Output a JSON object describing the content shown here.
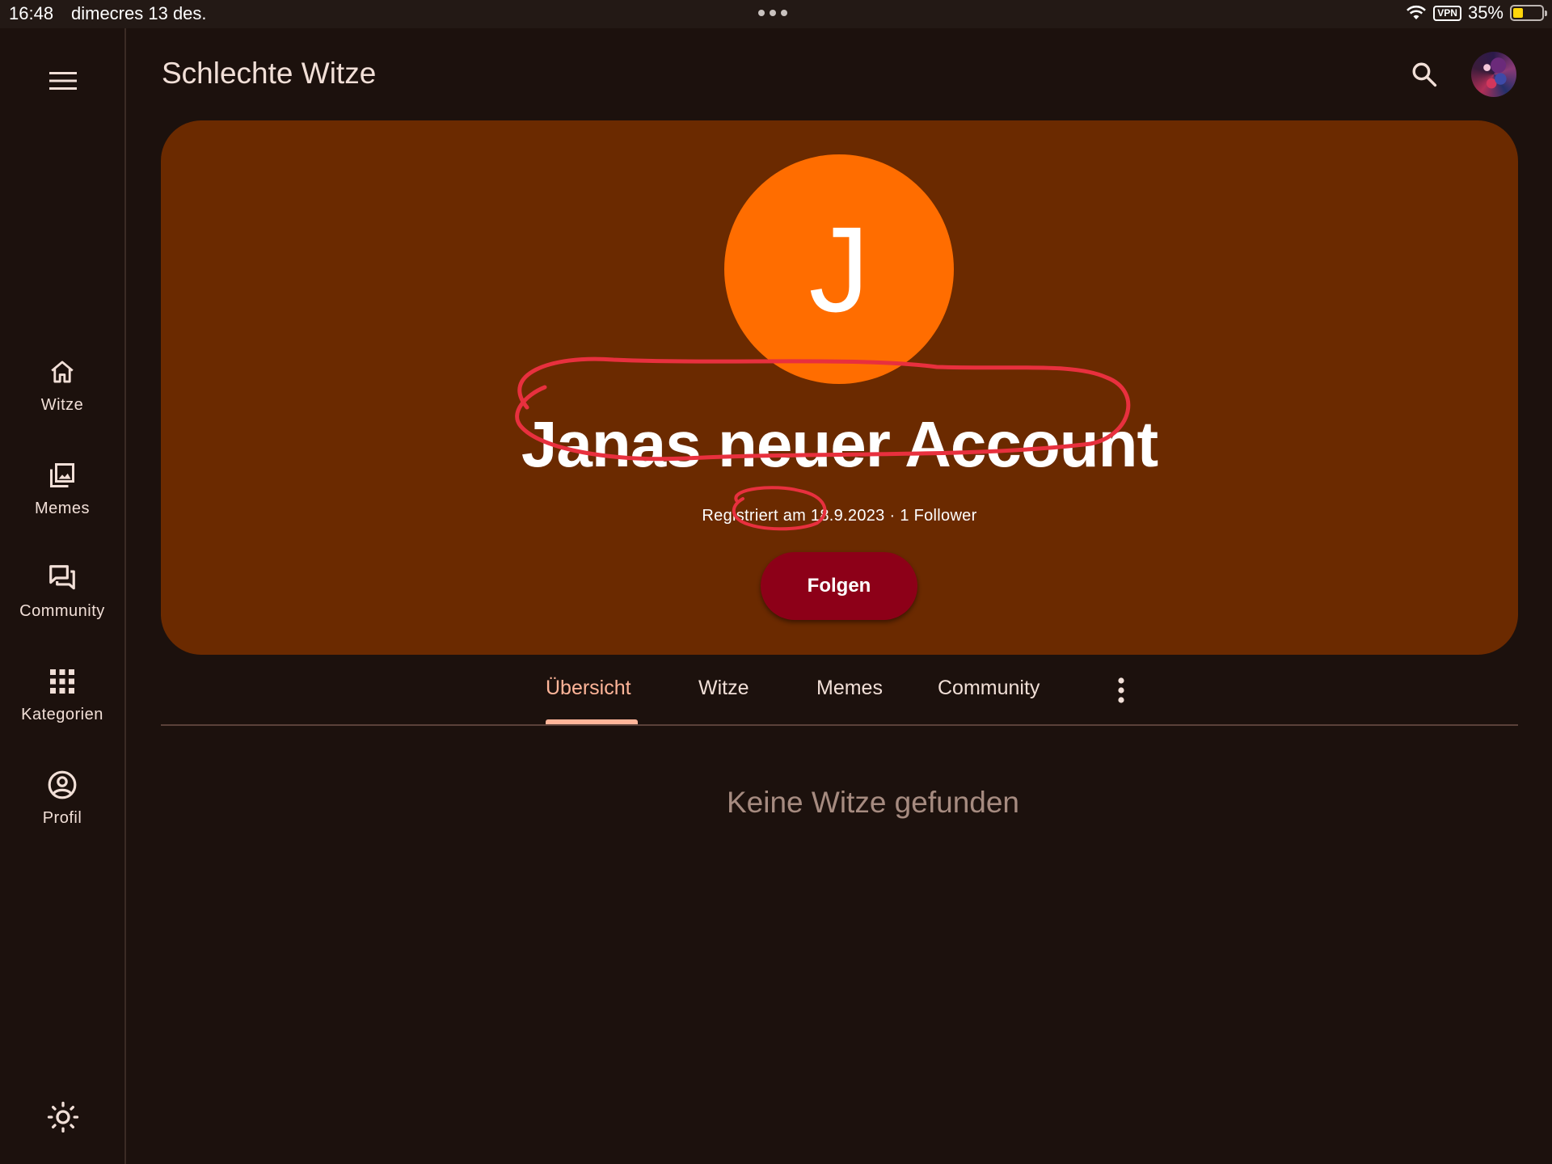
{
  "status_bar": {
    "time": "16:48",
    "date": "dimecres 13 des.",
    "vpn": "VPN",
    "battery": "35%",
    "battery_level": 0.35
  },
  "app_bar": {
    "title": "Schlechte Witze",
    "search_icon": "search-icon",
    "menu_icon": "menu-icon"
  },
  "nav_rail": {
    "items": [
      {
        "label": "Witze",
        "icon": "home-icon"
      },
      {
        "label": "Memes",
        "icon": "photo-library-icon"
      },
      {
        "label": "Community",
        "icon": "forum-icon"
      },
      {
        "label": "Kategorien",
        "icon": "apps-grid-icon"
      },
      {
        "label": "Profil",
        "icon": "account-circle-icon"
      }
    ],
    "theme_icon": "brightness-icon"
  },
  "profile": {
    "initial": "J",
    "name": "Janas neuer Account",
    "registered": "Registriert am 18.9.2023",
    "separator": " · ",
    "followers": "1 Follower",
    "follow_button": "Folgen"
  },
  "tabs": [
    {
      "label": "Übersicht",
      "active": true
    },
    {
      "label": "Witze",
      "active": false
    },
    {
      "label": "Memes",
      "active": false
    },
    {
      "label": "Community",
      "active": false
    }
  ],
  "empty_message": "Keine Witze gefunden",
  "colors": {
    "background": "#1c110d",
    "hero": "#6b2a00",
    "avatar": "#ff6d00",
    "follow_button": "#8d0018",
    "accent": "#ffb599",
    "annotation": "#e8303e"
  }
}
